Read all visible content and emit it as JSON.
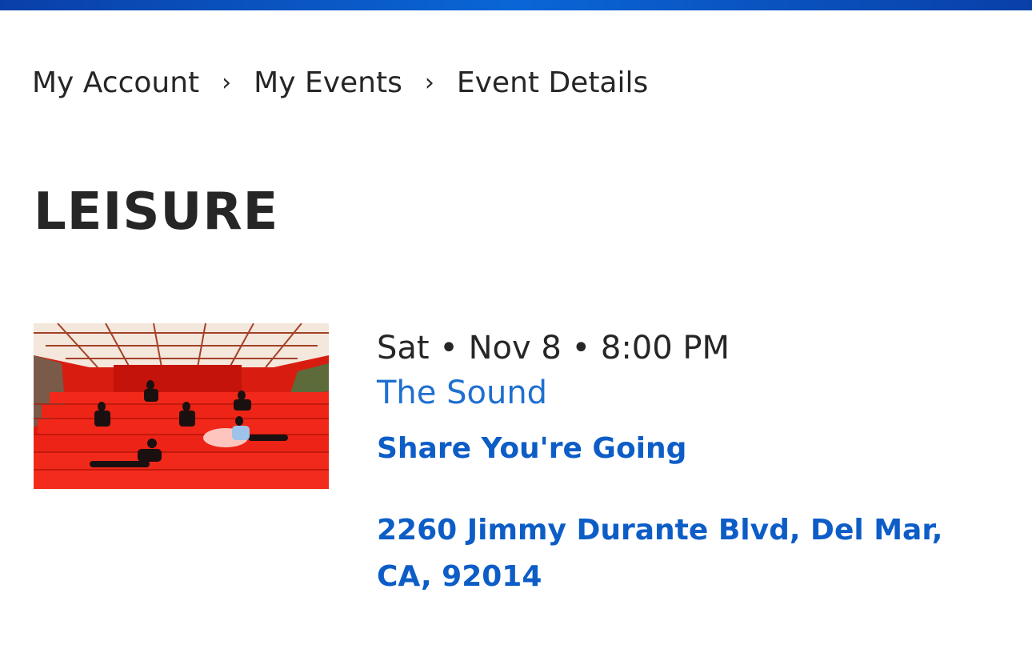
{
  "breadcrumb": {
    "items": [
      {
        "label": "My Account"
      },
      {
        "label": "My Events"
      },
      {
        "label": "Event Details"
      }
    ],
    "separator": "›"
  },
  "page": {
    "title": "LEISURE"
  },
  "event": {
    "image_description_icon": "event-photo",
    "date_line": "Sat • Nov 8 • 8:00 PM",
    "venue": "The Sound",
    "share_label": "Share You're Going",
    "address": "2260 Jimmy Durante Blvd, Del Mar, CA, 92014"
  },
  "colors": {
    "top_bar": "#0a4fc4",
    "link": "#0d5dc7",
    "venue_link": "#1f6fd0",
    "text": "#262626",
    "image_red": "#e61e0f"
  }
}
